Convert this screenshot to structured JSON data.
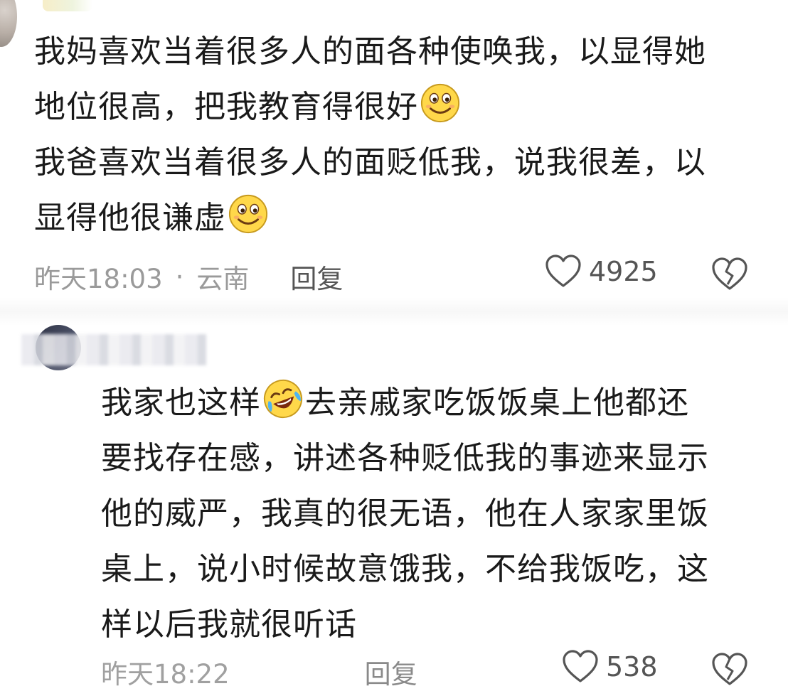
{
  "comment1": {
    "lines": [
      "我妈喜欢当着很多人的面各种使唤我，以显得她",
      "地位很高，把我教育得很好",
      "我爸喜欢当着很多人的面贬低我，说我很差，以",
      "显得他很谦虚"
    ],
    "emojis": [
      "smile-emoji",
      "smile-emoji"
    ],
    "time": "昨天18:03",
    "separator": "·",
    "location": "云南",
    "reply_label": "回复",
    "like_count": "4925"
  },
  "comment2": {
    "lines": [
      "我家也这样",
      "去亲戚家吃饭饭桌上他都还",
      "要找存在感，讲述各种贬低我的事迹来显示",
      "他的威严，我真的很无语，他在人家家里饭",
      "桌上，说小时候故意饿我，不给我饭吃，这",
      "样以后我就很听话"
    ],
    "emojis": [
      "laugh-cry-emoji"
    ],
    "time": "昨天18:22",
    "reply_label": "回复",
    "like_count": "538"
  },
  "colors": {
    "meta_text": "#9a9a9a",
    "reply_text": "#555555",
    "body_text": "#1a1a1a"
  }
}
